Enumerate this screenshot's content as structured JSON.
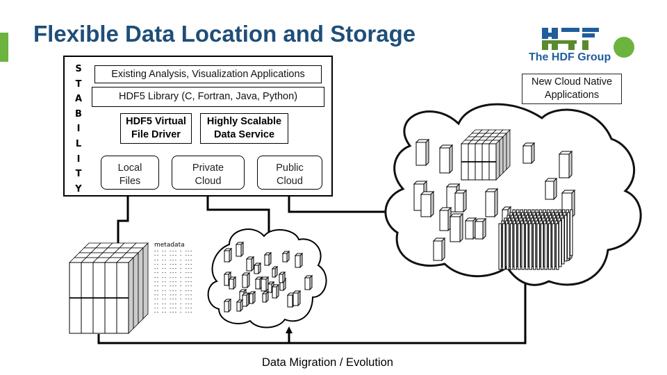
{
  "slide": {
    "title": "Flexible Data Location and Storage",
    "accent_color": "#6db33f",
    "title_color": "#1f4e79"
  },
  "logo": {
    "name": "HDF logo",
    "text": "The HDF Group",
    "mark_top_color": "#1f5d9c",
    "mark_bottom_color": "#5a8a2e"
  },
  "cloud_native_box": {
    "line1": "New Cloud Native",
    "line2": "Applications"
  },
  "stack": {
    "side_label_letters": [
      "S",
      "T",
      "A",
      "B",
      "I",
      "L",
      "I",
      "T",
      "Y"
    ],
    "side_label": "STABILITY",
    "layers": {
      "apps": "Existing Analysis, Visualization Applications",
      "library": "HDF5 Library (C, Fortran, Java, Python)"
    },
    "drivers": {
      "vfd_line1": "HDF5 Virtual",
      "vfd_line2": "File Driver",
      "hsds_line1": "Highly Scalable",
      "hsds_line2": "Data Service"
    },
    "storage": {
      "local_line1": "Local",
      "local_line2": "Files",
      "private_line1": "Private",
      "private_line2": "Cloud",
      "public_line1": "Public",
      "public_line2": "Cloud"
    }
  },
  "metadata": {
    "label": "metadata",
    "row_pattern": "-- -- --- - ---",
    "row_count": 15
  },
  "caption": "Data Migration / Evolution"
}
